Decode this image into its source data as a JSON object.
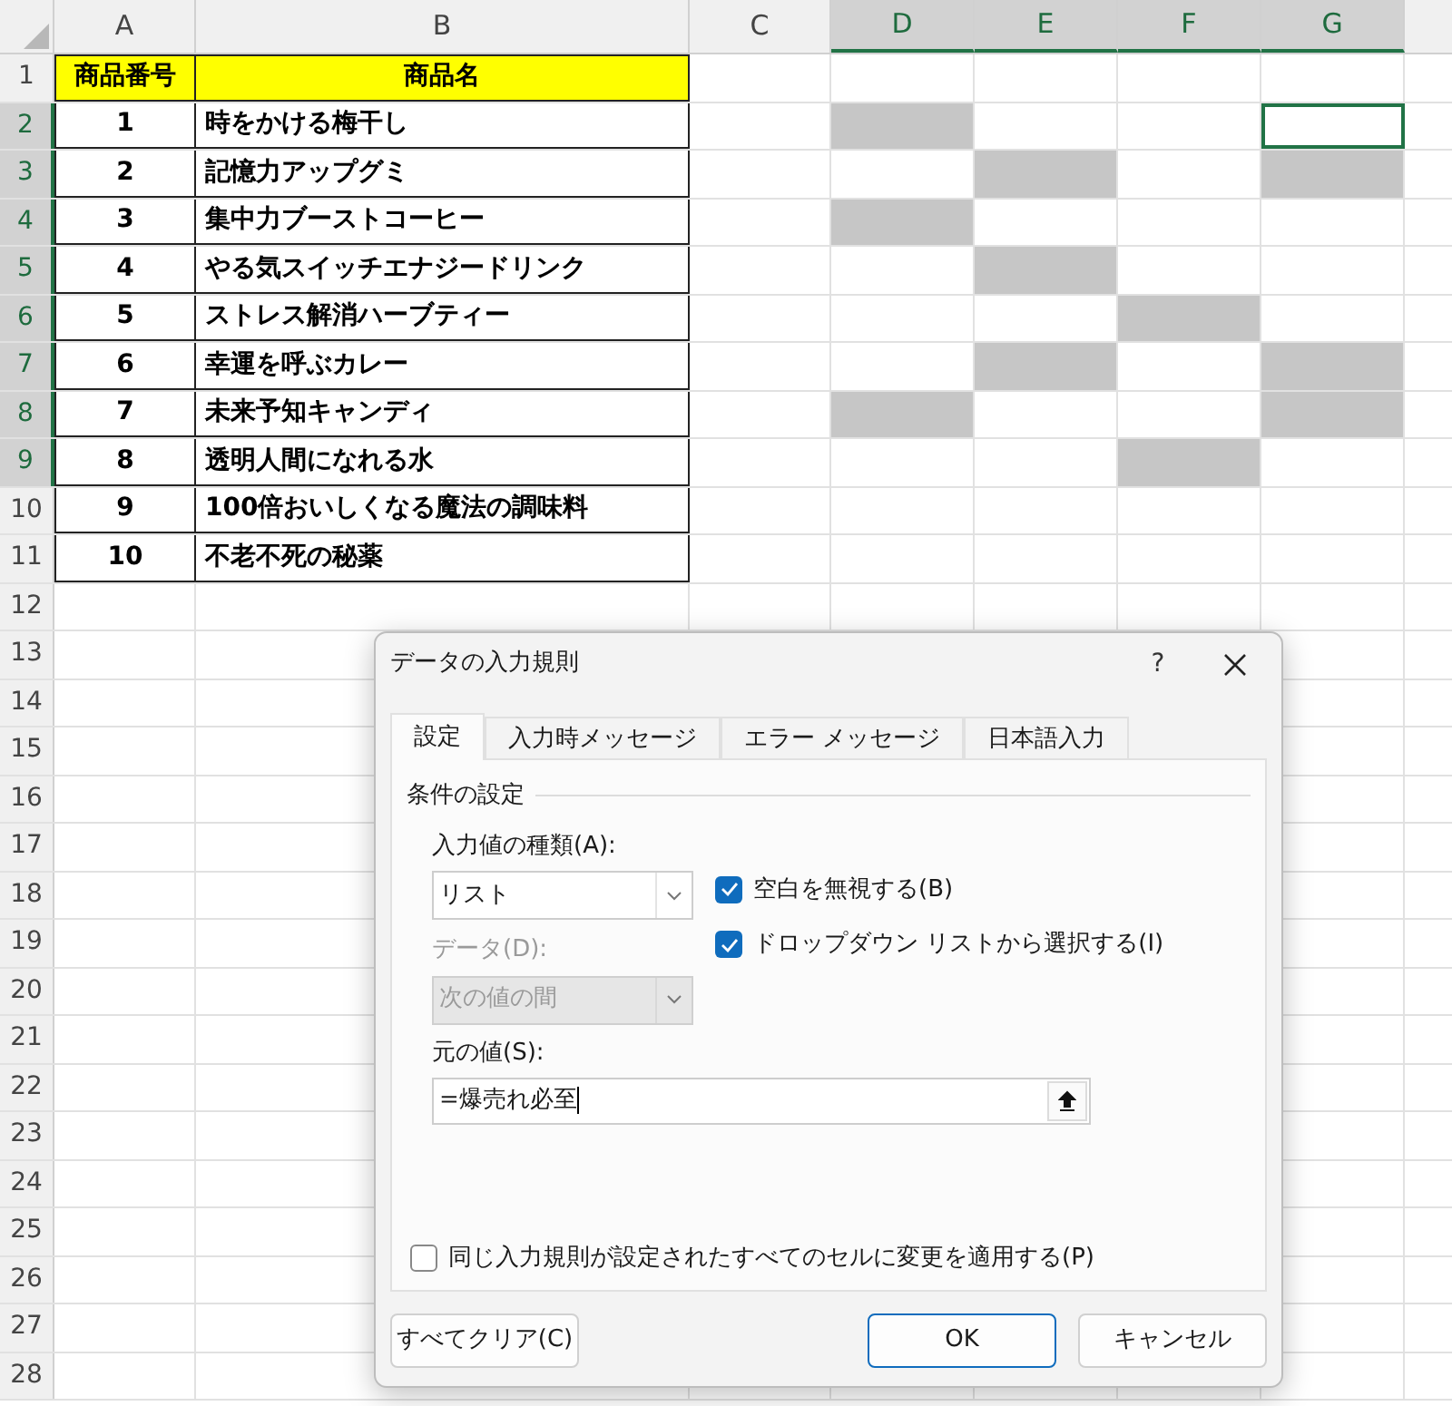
{
  "columns": [
    {
      "label": "A",
      "selected": false
    },
    {
      "label": "B",
      "selected": false
    },
    {
      "label": "C",
      "selected": false
    },
    {
      "label": "D",
      "selected": true
    },
    {
      "label": "E",
      "selected": true
    },
    {
      "label": "F",
      "selected": true
    },
    {
      "label": "G",
      "selected": true
    }
  ],
  "table": {
    "header": [
      "商品番号",
      "商品名"
    ],
    "rows": [
      {
        "id": "1",
        "name": "時をかける梅干し"
      },
      {
        "id": "2",
        "name": "記憶力アップグミ"
      },
      {
        "id": "3",
        "name": "集中力ブーストコーヒー"
      },
      {
        "id": "4",
        "name": "やる気スイッチエナジードリンク"
      },
      {
        "id": "5",
        "name": "ストレス解消ハーブティー"
      },
      {
        "id": "6",
        "name": "幸運を呼ぶカレー"
      },
      {
        "id": "7",
        "name": "未来予知キャンディ"
      },
      {
        "id": "8",
        "name": "透明人間になれる水"
      },
      {
        "id": "9",
        "name": "100倍おいしくなる魔法の調味料"
      },
      {
        "id": "10",
        "name": "不老不死の秘薬"
      }
    ]
  },
  "rows": [
    {
      "label": "1",
      "selected": false
    },
    {
      "label": "2",
      "selected": true,
      "cells": [
        {
          "selected": true,
          "active": false
        },
        {
          "selected": false,
          "active": false
        },
        {
          "selected": false,
          "active": false
        },
        {
          "selected": false,
          "active": true
        }
      ]
    },
    {
      "label": "3",
      "selected": true,
      "cells": [
        {
          "selected": false,
          "active": false
        },
        {
          "selected": true,
          "active": false
        },
        {
          "selected": false,
          "active": false
        },
        {
          "selected": true,
          "active": false
        }
      ]
    },
    {
      "label": "4",
      "selected": true,
      "cells": [
        {
          "selected": true,
          "active": false
        },
        {
          "selected": false,
          "active": false
        },
        {
          "selected": false,
          "active": false
        },
        {
          "selected": false,
          "active": false
        }
      ]
    },
    {
      "label": "5",
      "selected": true,
      "cells": [
        {
          "selected": false,
          "active": false
        },
        {
          "selected": true,
          "active": false
        },
        {
          "selected": false,
          "active": false
        },
        {
          "selected": false,
          "active": false
        }
      ]
    },
    {
      "label": "6",
      "selected": true,
      "cells": [
        {
          "selected": false,
          "active": false
        },
        {
          "selected": false,
          "active": false
        },
        {
          "selected": true,
          "active": false
        },
        {
          "selected": false,
          "active": false
        }
      ]
    },
    {
      "label": "7",
      "selected": true,
      "cells": [
        {
          "selected": false,
          "active": false
        },
        {
          "selected": true,
          "active": false
        },
        {
          "selected": false,
          "active": false
        },
        {
          "selected": true,
          "active": false
        }
      ]
    },
    {
      "label": "8",
      "selected": true,
      "cells": [
        {
          "selected": true,
          "active": false
        },
        {
          "selected": false,
          "active": false
        },
        {
          "selected": false,
          "active": false
        },
        {
          "selected": true,
          "active": false
        }
      ]
    },
    {
      "label": "9",
      "selected": true,
      "cells": [
        {
          "selected": false,
          "active": false
        },
        {
          "selected": false,
          "active": false
        },
        {
          "selected": true,
          "active": false
        },
        {
          "selected": false,
          "active": false
        }
      ]
    },
    {
      "label": "10",
      "selected": false
    },
    {
      "label": "11",
      "selected": false
    },
    {
      "label": "12",
      "selected": false
    },
    {
      "label": "13",
      "selected": false
    },
    {
      "label": "14",
      "selected": false
    },
    {
      "label": "15",
      "selected": false
    },
    {
      "label": "16",
      "selected": false
    },
    {
      "label": "17",
      "selected": false
    },
    {
      "label": "18",
      "selected": false
    },
    {
      "label": "19",
      "selected": false
    },
    {
      "label": "20",
      "selected": false
    },
    {
      "label": "21",
      "selected": false
    },
    {
      "label": "22",
      "selected": false
    },
    {
      "label": "23",
      "selected": false
    },
    {
      "label": "24",
      "selected": false
    },
    {
      "label": "25",
      "selected": false
    },
    {
      "label": "26",
      "selected": false
    },
    {
      "label": "27",
      "selected": false
    },
    {
      "label": "28",
      "selected": false
    }
  ],
  "dialog": {
    "title": "データの入力規則",
    "help": "?",
    "tabs": [
      {
        "label": "設定",
        "selected": true
      },
      {
        "label": "入力時メッセージ",
        "selected": false
      },
      {
        "label": "エラー メッセージ",
        "selected": false
      },
      {
        "label": "日本語入力",
        "selected": false
      }
    ],
    "group": "条件の設定",
    "type_label": "入力値の種類(A):",
    "type_value": "リスト",
    "data_label": "データ(D):",
    "data_value": "次の値の間",
    "data_disabled": true,
    "checkboxes": [
      {
        "label": "空白を無視する(B)",
        "checked": true
      },
      {
        "label": "ドロップダウン リストから選択する(I)",
        "checked": true
      }
    ],
    "source_label": "元の値(S):",
    "source_value": "=爆売れ必至",
    "apply_all": {
      "label": "同じ入力規則が設定されたすべてのセルに変更を適用する(P)",
      "checked": false
    },
    "buttons": [
      {
        "label": "すべてクリア(C)",
        "kind": "secondary"
      },
      {
        "label": "OK",
        "kind": "default"
      },
      {
        "label": "キャンセル",
        "kind": "secondary"
      }
    ]
  }
}
